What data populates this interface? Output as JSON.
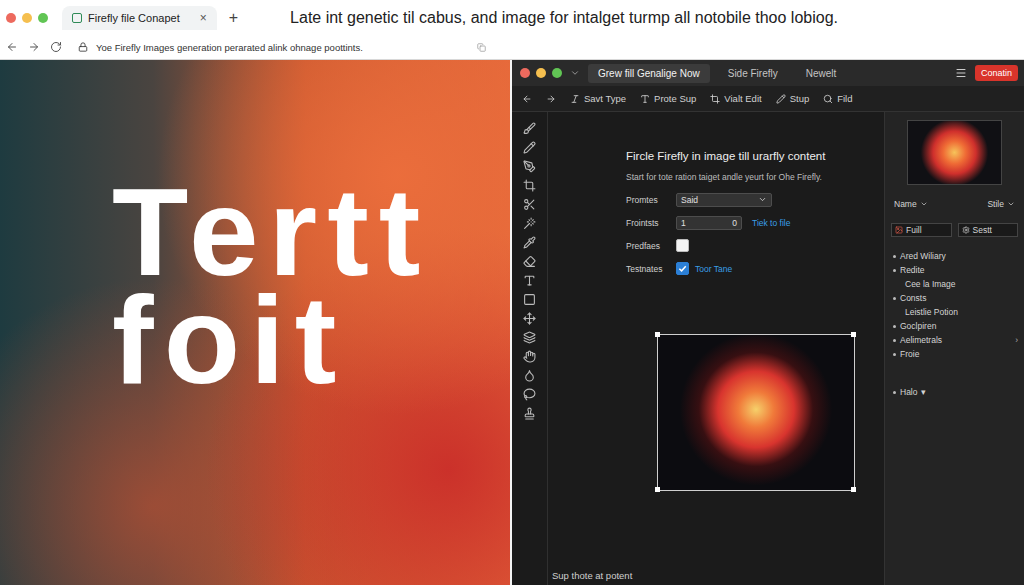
{
  "browser": {
    "tab": {
      "title": "Firefly file Conapet",
      "close": "×"
    },
    "new_tab": "+",
    "headline": "Late int genetic til cabus, and image for intalget turmp all notobile thoo lobiog.",
    "address": "Yoe Firefly Images generation perarated alink ohnage poottints."
  },
  "hero": {
    "lines": [
      "Tertt",
      "foit"
    ]
  },
  "app": {
    "tabs": [
      {
        "label": "Grew fill Genalige Now",
        "selected": true
      },
      {
        "label": "Side Firefly",
        "selected": false
      },
      {
        "label": "Newelt",
        "selected": false
      }
    ],
    "action_button": "Conatin",
    "toolbar": [
      "Savt Type",
      "Prote Sup",
      "Vialt Edit",
      "Stup",
      "Fild"
    ],
    "panel": {
      "title": "Fircle Firefly in image till urarfly content",
      "subtitle": "Start for tote ration taiget andle yeurt for Ohe Firefly.",
      "form": [
        {
          "label": "Promtes",
          "kind": "select",
          "value": "Said"
        },
        {
          "label": "Frointsts",
          "kind": "number",
          "value": "1",
          "second": "0",
          "link": "Tiek to file"
        },
        {
          "label": "Predfaes",
          "kind": "checkbox",
          "checked": false
        },
        {
          "label": "Testnates",
          "kind": "checkbox",
          "checked": true,
          "text": "Toor Tane"
        }
      ]
    },
    "inspector": {
      "selects": [
        "Name",
        "Stile"
      ],
      "inputs": [
        "Fuill",
        "Sestt"
      ],
      "tree": [
        {
          "label": "Ared Wiliary",
          "indent": false
        },
        {
          "label": "Redite",
          "indent": false
        },
        {
          "label": "Cee la Image",
          "indent": true
        },
        {
          "label": "Consts",
          "indent": false
        },
        {
          "label": "Leistlie Potion",
          "indent": true
        },
        {
          "label": "Goclpiren",
          "indent": false
        },
        {
          "label": "Aelimetrals",
          "indent": false,
          "suffix": "›"
        },
        {
          "label": "Froie",
          "indent": false
        }
      ],
      "footer_item": {
        "label": "Halo",
        "suffix": "▾"
      }
    },
    "footer": "Sup thote at potent"
  }
}
